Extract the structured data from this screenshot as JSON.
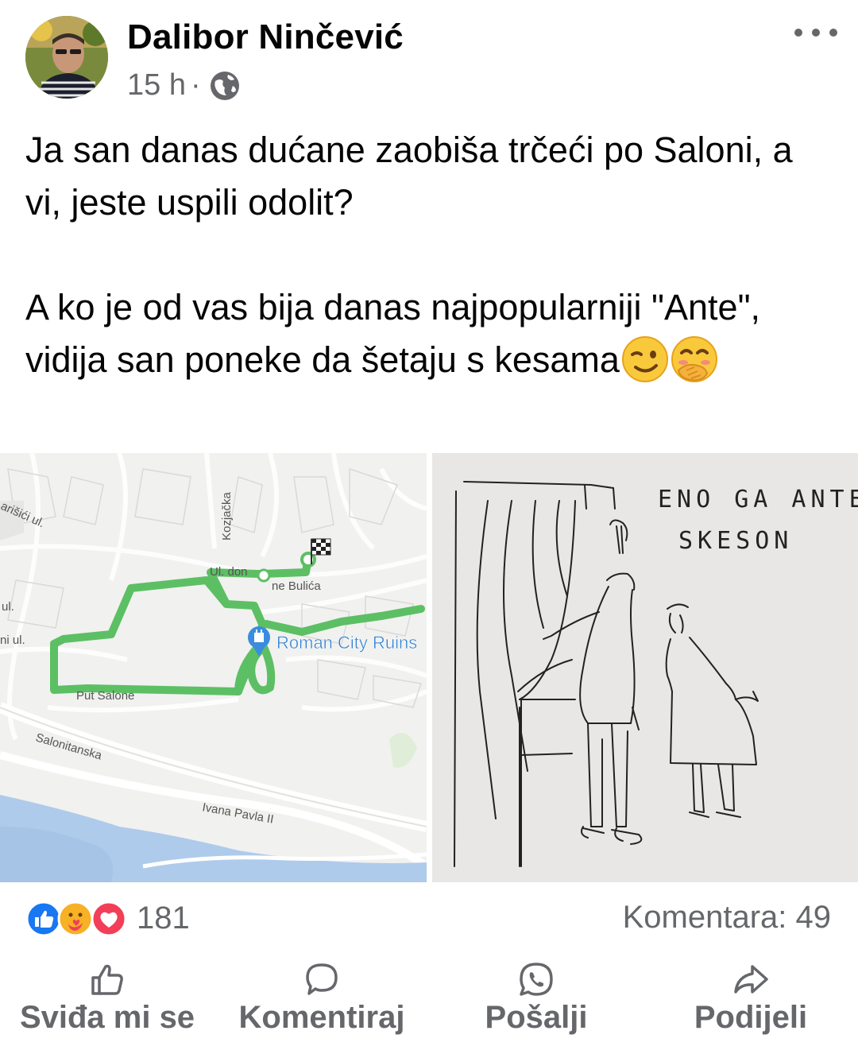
{
  "post": {
    "author": "Dalibor Ninčević",
    "time": "15 h",
    "separator": "·",
    "privacy_icon": "globe-icon",
    "more_icon": "more-options-icon",
    "text": "Ja san danas dućane zaobiša trčeći po Saloni, a vi, jeste uspili odolit?\n\nA ko je od vas bija danas najpopularniji \"Ante\", vidija san poneke da šetaju s kesama",
    "emojis": [
      "winking-face",
      "face-with-hand-over-mouth"
    ]
  },
  "map": {
    "labels": {
      "street1": "Ul. don Frane Bulića",
      "street1_a": "Ul. don",
      "street1_b": "ne Bulića",
      "kozjacka": "Kozjačka",
      "poi": "Roman City Ruins",
      "put_salone": "Put Salone",
      "salonitanska": "Salonitanska",
      "ivana_pavla": "Ivana Pavla II",
      "left1": "arišići ul.",
      "left2": "ul.",
      "left3": "ni ul."
    },
    "route_color": "#5cbf64"
  },
  "drawing": {
    "line1": "ENO GA ANTE",
    "line2": "SKESON"
  },
  "stats": {
    "reaction_count": "181",
    "comments": "Komentara: 49",
    "reaction_icons": [
      "like-icon",
      "care-icon",
      "love-icon"
    ]
  },
  "actions": [
    {
      "label": "Sviđa mi se",
      "icon": "thumbs-up-icon"
    },
    {
      "label": "Komentiraj",
      "icon": "comment-icon"
    },
    {
      "label": "Pošalji",
      "icon": "whatsapp-icon"
    },
    {
      "label": "Podijeli",
      "icon": "share-icon"
    }
  ],
  "colors": {
    "like_blue": "#1877f2",
    "love_red": "#f33e58",
    "care_yellow": "#f7b125",
    "muted_text": "#65676b"
  }
}
